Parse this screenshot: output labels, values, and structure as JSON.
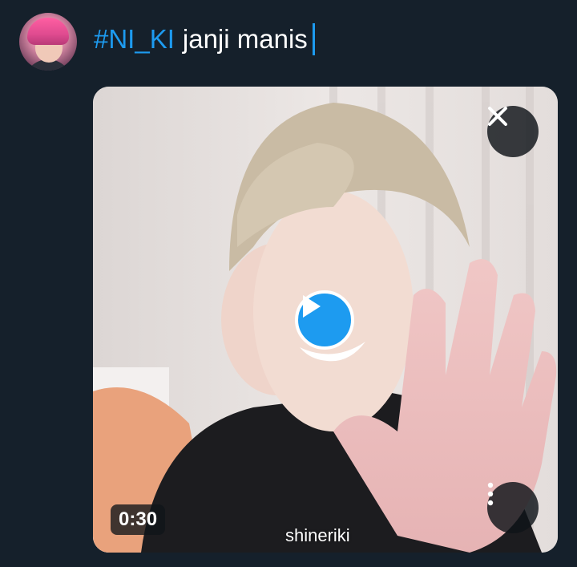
{
  "compose": {
    "hashtag": "#NI_KI",
    "text": "janji manis"
  },
  "media": {
    "duration": "0:30",
    "watermark": "shineriki"
  },
  "icons": {
    "close": "close-icon",
    "play": "play-icon",
    "more": "more-vertical-icon"
  },
  "colors": {
    "background": "#15202b",
    "accent": "#1d9bf0",
    "text": "#ffffff"
  }
}
